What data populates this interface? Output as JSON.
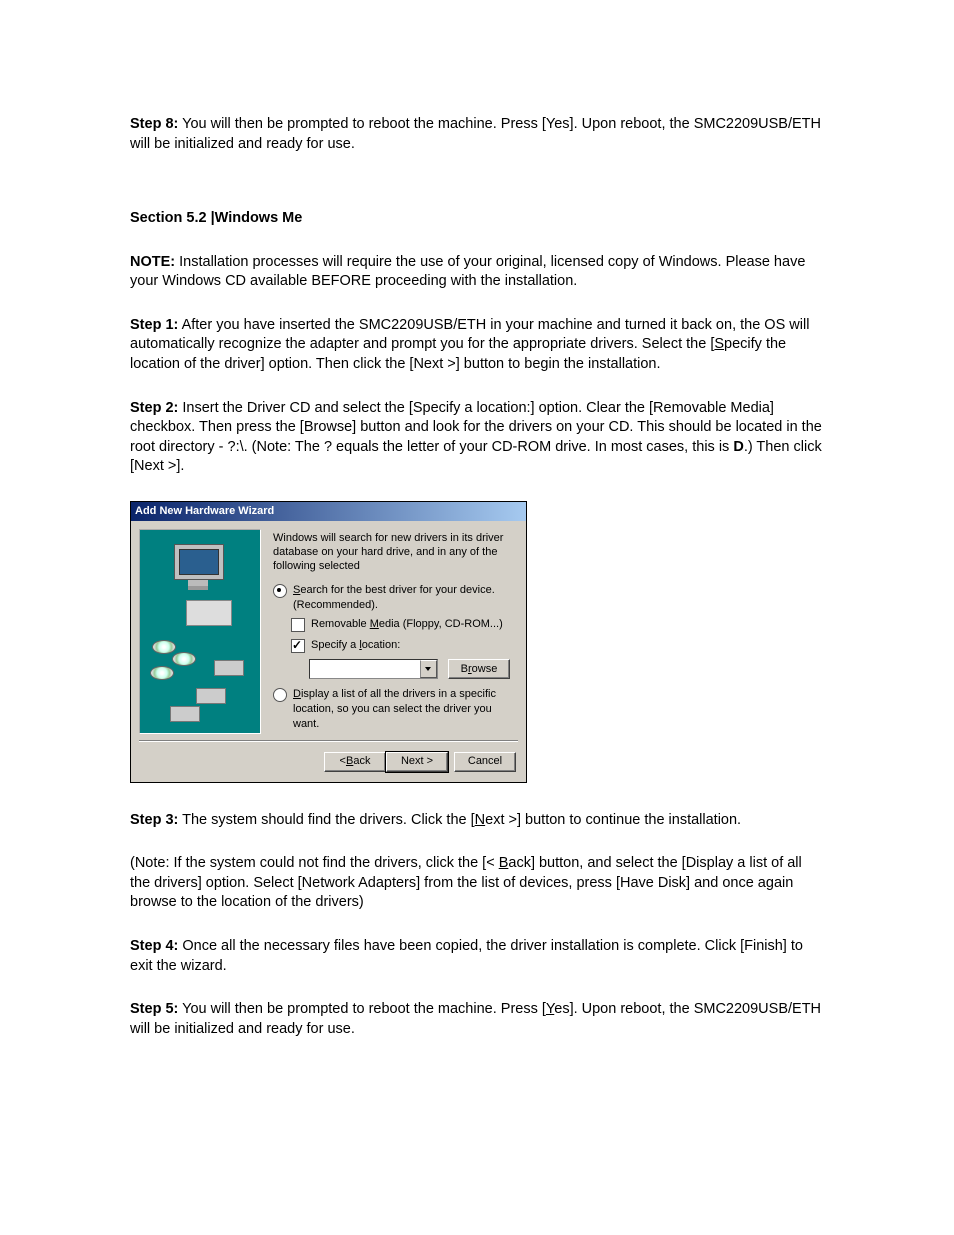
{
  "step8": {
    "label": "Step 8:",
    "text": " You will then be prompted to reboot the machine. Press [Yes]. Upon reboot, the SMC2209USB/ETH will be initialized and ready for use."
  },
  "section_title": "Section 5.2 |Windows Me",
  "note": {
    "label": "NOTE:",
    "text": " Installation processes will require the use of your original, licensed copy of Windows. Please have your Windows CD available BEFORE proceeding with the installation."
  },
  "step1": {
    "label": "Step 1:",
    "pre": " After you have inserted the SMC2209USB/ETH in your machine and turned it back on, the OS will automatically recognize the adapter and prompt you for the appropriate drivers. Select the [",
    "u1_pre": "S",
    "u1_post": "pecify the location of the driver] option. Then click the [Next >] button to begin the installation."
  },
  "step2": {
    "label": "Step 2:",
    "pre": " Insert the Driver CD and select the [Specify a location:] option. Clear the [Removable Media] checkbox. Then press the [Browse] button and look for the drivers on your CD. This should be located in the root directory - ?:\\. (Note: The ? equals the letter of your CD-ROM drive. In most cases, this is ",
    "bold": "D",
    "post": ".) Then click [Next >]."
  },
  "wizard": {
    "title": "Add New Hardware Wizard",
    "intro": "Windows will search for new drivers in its driver database on your hard drive, and in any of the following selected",
    "opt1_pre": "S",
    "opt1_post": "earch for the best driver for your device. (Recommended).",
    "chk1_pre": "Removable ",
    "chk1_u": "M",
    "chk1_post": "edia (Floppy, CD-ROM...)",
    "chk2_pre": "Specify a ",
    "chk2_u": "l",
    "chk2_post": "ocation:",
    "browse_pre": "B",
    "browse_u": "r",
    "browse_post": "owse",
    "opt2_pre": "D",
    "opt2_post": "isplay a list of all the drivers in a specific location, so you can select the driver you want.",
    "back_pre": "< ",
    "back_u": "B",
    "back_post": "ack",
    "next": "Next >",
    "cancel": "Cancel"
  },
  "step3": {
    "label": "Step 3:",
    "pre": " The system should find the drivers. Click the [",
    "u": "N",
    "post": "ext >] button to continue the installation."
  },
  "note2": {
    "pre": "(Note: If the system could not find the drivers, click the [< ",
    "u": "B",
    "post": "ack] button, and select the [Display a list of all the drivers] option. Select [Network Adapters] from the list of devices, press [Have Disk] and once again browse to the location of the drivers)"
  },
  "step4": {
    "label": "Step 4:",
    "text": " Once all the necessary files have been copied, the driver installation is complete. Click [Finish] to exit the wizard."
  },
  "step5": {
    "label": "Step 5:",
    "pre": " You will then be prompted to reboot the machine. Press [",
    "u": "Y",
    "post": "es]. Upon reboot, the SMC2209USB/ETH will be initialized and ready for use."
  }
}
